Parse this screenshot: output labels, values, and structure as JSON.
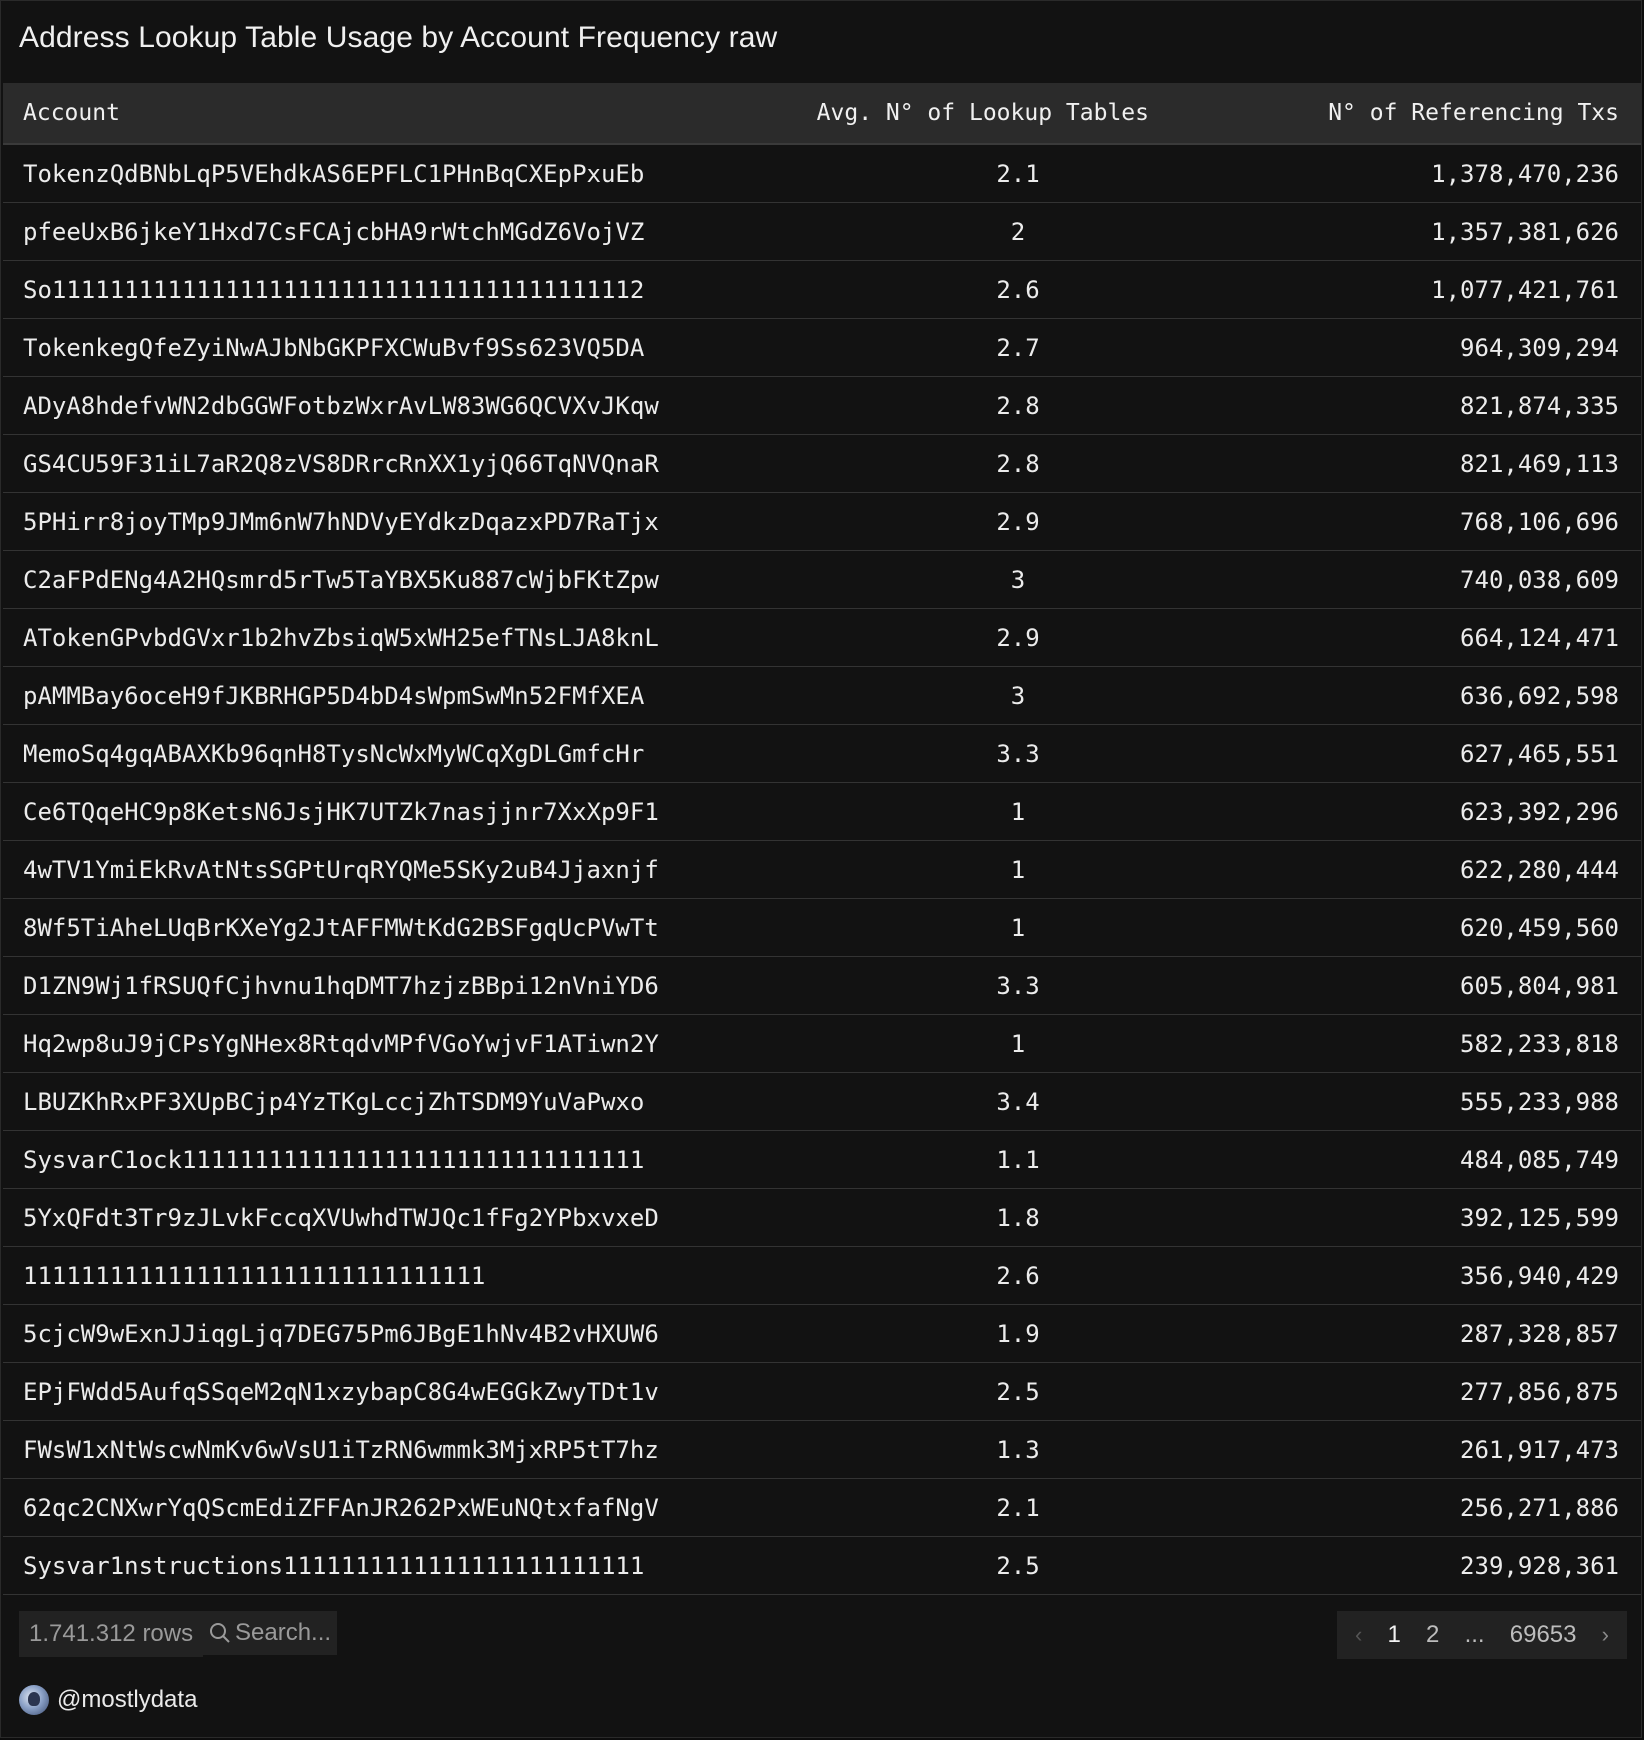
{
  "title": "Address Lookup Table Usage by Account Frequency raw",
  "table": {
    "columns": [
      "Account",
      "Avg. N° of Lookup Tables",
      "N° of Referencing Txs"
    ],
    "rows": [
      {
        "account": "TokenzQdBNbLqP5VEhdkAS6EPFLC1PHnBqCXEpPxuEb",
        "avg": "2.1",
        "txs": "1,378,470,236"
      },
      {
        "account": "pfeeUxB6jkeY1Hxd7CsFCAjcbHA9rWtchMGdZ6VojVZ",
        "avg": "2",
        "txs": "1,357,381,626"
      },
      {
        "account": "So11111111111111111111111111111111111111112",
        "avg": "2.6",
        "txs": "1,077,421,761"
      },
      {
        "account": "TokenkegQfeZyiNwAJbNbGKPFXCWuBvf9Ss623VQ5DA",
        "avg": "2.7",
        "txs": "964,309,294"
      },
      {
        "account": "ADyA8hdefvWN2dbGGWFotbzWxrAvLW83WG6QCVXvJKqw",
        "avg": "2.8",
        "txs": "821,874,335"
      },
      {
        "account": "GS4CU59F31iL7aR2Q8zVS8DRrcRnXX1yjQ66TqNVQnaR",
        "avg": "2.8",
        "txs": "821,469,113"
      },
      {
        "account": "5PHirr8joyTMp9JMm6nW7hNDVyEYdkzDqazxPD7RaTjx",
        "avg": "2.9",
        "txs": "768,106,696"
      },
      {
        "account": "C2aFPdENg4A2HQsmrd5rTw5TaYBX5Ku887cWjbFKtZpw",
        "avg": "3",
        "txs": "740,038,609"
      },
      {
        "account": "ATokenGPvbdGVxr1b2hvZbsiqW5xWH25efTNsLJA8knL",
        "avg": "2.9",
        "txs": "664,124,471"
      },
      {
        "account": "pAMMBay6oceH9fJKBRHGP5D4bD4sWpmSwMn52FMfXEA",
        "avg": "3",
        "txs": "636,692,598"
      },
      {
        "account": "MemoSq4gqABAXKb96qnH8TysNcWxMyWCqXgDLGmfcHr",
        "avg": "3.3",
        "txs": "627,465,551"
      },
      {
        "account": "Ce6TQqeHC9p8KetsN6JsjHK7UTZk7nasjjnr7XxXp9F1",
        "avg": "1",
        "txs": "623,392,296"
      },
      {
        "account": "4wTV1YmiEkRvAtNtsSGPtUrqRYQMe5SKy2uB4Jjaxnjf",
        "avg": "1",
        "txs": "622,280,444"
      },
      {
        "account": "8Wf5TiAheLUqBrKXeYg2JtAFFMWtKdG2BSFgqUcPVwTt",
        "avg": "1",
        "txs": "620,459,560"
      },
      {
        "account": "D1ZN9Wj1fRSUQfCjhvnu1hqDMT7hzjzBBpi12nVniYD6",
        "avg": "3.3",
        "txs": "605,804,981"
      },
      {
        "account": "Hq2wp8uJ9jCPsYgNHex8RtqdvMPfVGoYwjvF1ATiwn2Y",
        "avg": "1",
        "txs": "582,233,818"
      },
      {
        "account": "LBUZKhRxPF3XUpBCjp4YzTKgLccjZhTSDM9YuVaPwxo",
        "avg": "3.4",
        "txs": "555,233,988"
      },
      {
        "account": "SysvarC1ock11111111111111111111111111111111",
        "avg": "1.1",
        "txs": "484,085,749"
      },
      {
        "account": "5YxQFdt3Tr9zJLvkFccqXVUwhdTWJQc1fFg2YPbxvxeD",
        "avg": "1.8",
        "txs": "392,125,599"
      },
      {
        "account": "11111111111111111111111111111111",
        "avg": "2.6",
        "txs": "356,940,429"
      },
      {
        "account": "5cjcW9wExnJJiqgLjq7DEG75Pm6JBgE1hNv4B2vHXUW6",
        "avg": "1.9",
        "txs": "287,328,857"
      },
      {
        "account": "EPjFWdd5AufqSSqeM2qN1xzybapC8G4wEGGkZwyTDt1v",
        "avg": "2.5",
        "txs": "277,856,875"
      },
      {
        "account": "FWsW1xNtWscwNmKv6wVsU1iTzRN6wmmk3MjxRP5tT7hz",
        "avg": "1.3",
        "txs": "261,917,473"
      },
      {
        "account": "62qc2CNXwrYqQScmEdiZFFAnJR262PxWEuNQtxfafNgV",
        "avg": "2.1",
        "txs": "256,271,886"
      },
      {
        "account": "Sysvar1nstructions1111111111111111111111111",
        "avg": "2.5",
        "txs": "239,928,361"
      }
    ]
  },
  "footer": {
    "rows_count": "1.741.312 rows",
    "search_placeholder": "Search...",
    "pages": [
      "1",
      "2",
      "...",
      "69653"
    ],
    "prev_icon": "chevron-left-icon",
    "next_icon": "chevron-right-icon",
    "search_icon": "search-icon"
  },
  "author": {
    "handle": "@mostlydata"
  },
  "colors": {
    "background": "#121212",
    "header_bg": "#2b2b2b",
    "text": "#ececec",
    "muted": "#9a9a9a"
  }
}
